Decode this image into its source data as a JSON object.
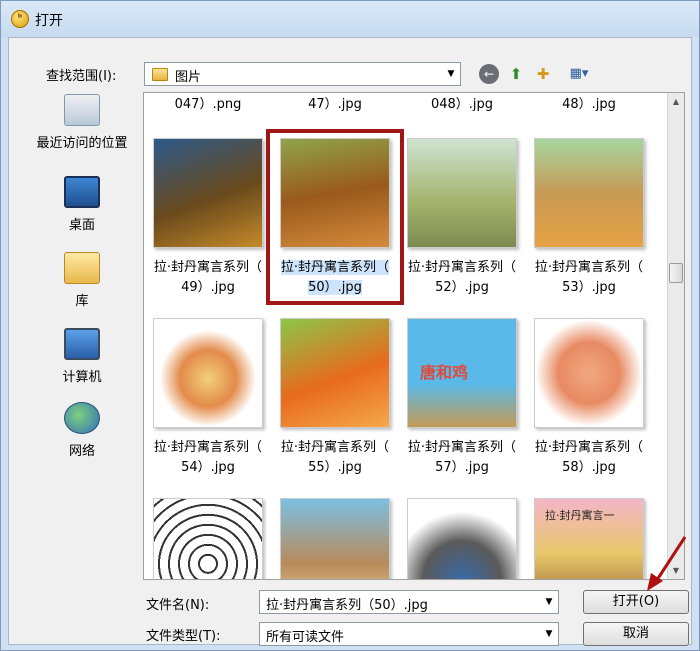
{
  "window": {
    "title": "打开",
    "app_icon": "app-logo-icon"
  },
  "lookin": {
    "label": "查找范围(I):",
    "value": "图片"
  },
  "places": [
    {
      "label": "最近访问的位置",
      "icon": "recent-places-icon"
    },
    {
      "label": "桌面",
      "icon": "desktop-icon"
    },
    {
      "label": "库",
      "icon": "libraries-icon"
    },
    {
      "label": "计算机",
      "icon": "computer-icon"
    },
    {
      "label": "网络",
      "icon": "network-icon"
    }
  ],
  "partial_top_row": [
    "047）.png",
    "47）.jpg",
    "048）.jpg",
    "48）.jpg"
  ],
  "files": [
    {
      "line1": "拉·封丹寓言系列（",
      "line2": "49）.jpg",
      "selected": false,
      "colors": [
        "#2d5a8a",
        "#6a4a1c",
        "#c58a2a"
      ]
    },
    {
      "line1": "拉·封丹寓言系列（",
      "line2": "50）.jpg",
      "selected": true,
      "colors": [
        "#8ea44a",
        "#9a5a1c",
        "#d48a3a"
      ]
    },
    {
      "line1": "拉·封丹寓言系列（",
      "line2": "52）.jpg",
      "selected": false,
      "colors": [
        "#cfe3d2",
        "#a3b26a",
        "#7c8a52"
      ]
    },
    {
      "line1": "拉·封丹寓言系列（",
      "line2": "53）.jpg",
      "selected": false,
      "colors": [
        "#a6d6a0",
        "#c79a54",
        "#e7a244"
      ]
    },
    {
      "line1": "拉·封丹寓言系列（",
      "line2": "54）.jpg",
      "selected": false,
      "colors": [
        "#ffffff",
        "#f3cf7a",
        "#e38b4a"
      ]
    },
    {
      "line1": "拉·封丹寓言系列（",
      "line2": "55）.jpg",
      "selected": false,
      "colors": [
        "#8bc64a",
        "#e86a1e",
        "#f4a94a"
      ]
    },
    {
      "line1": "拉·封丹寓言系列（",
      "line2": "57）.jpg",
      "selected": false,
      "colors": [
        "#5ab9e8",
        "#e04a3a",
        "#c49a54"
      ]
    },
    {
      "line1": "拉·封丹寓言系列（",
      "line2": "58）.jpg",
      "selected": false,
      "colors": [
        "#ffffff",
        "#f0a982",
        "#e88a62"
      ]
    },
    {
      "line1": "",
      "line2": "",
      "selected": false,
      "colors": [
        "#ffffff",
        "#ffffff",
        "#333333"
      ]
    },
    {
      "line1": "",
      "line2": "",
      "selected": false,
      "colors": [
        "#7ac0e2",
        "#b98a5a",
        "#e8d2a2"
      ]
    },
    {
      "line1": "",
      "line2": "",
      "selected": false,
      "colors": [
        "#ffffff",
        "#3a6aa8",
        "#5a5a5a"
      ]
    },
    {
      "line1": "",
      "line2": "",
      "selected": false,
      "colors": [
        "#f4b6c8",
        "#9a6a3a",
        "#e8c86a"
      ]
    }
  ],
  "filename": {
    "label": "文件名(N):",
    "value": "拉·封丹寓言系列（50）.jpg"
  },
  "filetype": {
    "label": "文件类型(T):",
    "value": "所有可读文件"
  },
  "buttons": {
    "open": "打开(O)",
    "cancel": "取消"
  },
  "thumb_texts": {
    "57": "唐和鸡",
    "last": "拉·封丹寓言一"
  },
  "colors": {
    "selection": "#cde4fb",
    "highlight_box": "#a01515",
    "arrow": "#b01010"
  }
}
